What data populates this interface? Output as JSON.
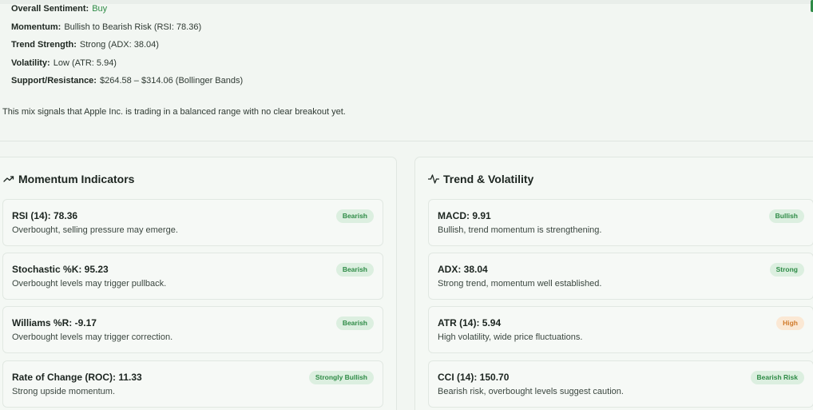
{
  "summary": {
    "rows": [
      {
        "label": "Overall Sentiment:",
        "value": "Buy"
      },
      {
        "label": "Momentum:",
        "value": "Bullish to Bearish Risk (RSI: 78.36)"
      },
      {
        "label": "Trend Strength:",
        "value": "Strong (ADX: 38.04)"
      },
      {
        "label": "Volatility:",
        "value": "Low (ATR: 5.94)"
      },
      {
        "label": "Support/Resistance:",
        "value": "$264.58 – $314.06 (Bollinger Bands)"
      }
    ],
    "note": "This mix signals that Apple Inc. is trading in a balanced range with no clear breakout yet."
  },
  "colors": {
    "accent": "#2e8b46",
    "badge_green_bg": "#dcefe0",
    "badge_orange_bg": "#fbe8d4",
    "badge_orange_text": "#d07a2a"
  },
  "momentum": {
    "title": "Momentum Indicators",
    "icon": "trending-up-icon",
    "cards": [
      {
        "title": "RSI (14): 78.36",
        "desc": "Overbought, selling pressure may emerge.",
        "badge": "Bearish"
      },
      {
        "title": "Stochastic %K: 95.23",
        "desc": "Overbought levels may trigger pullback.",
        "badge": "Bearish"
      },
      {
        "title": "Williams %R: -9.17",
        "desc": "Overbought levels may trigger correction.",
        "badge": "Bearish"
      },
      {
        "title": "Rate of Change (ROC): 11.33",
        "desc": "Strong upside momentum.",
        "badge": "Strongly Bullish"
      }
    ]
  },
  "trend": {
    "title": "Trend & Volatility",
    "icon": "activity-pulse-icon",
    "cards": [
      {
        "title": "MACD: 9.91",
        "desc": "Bullish, trend momentum is strengthening.",
        "badge": "Bullish"
      },
      {
        "title": "ADX: 38.04",
        "desc": "Strong trend, momentum well established.",
        "badge": "Strong"
      },
      {
        "title": "ATR (14): 5.94",
        "desc": "High volatility, wide price fluctuations.",
        "badge": "High"
      },
      {
        "title": "CCI (14): 150.70",
        "desc": "Bearish risk, overbought levels suggest caution.",
        "badge": "Bearish Risk"
      }
    ]
  }
}
